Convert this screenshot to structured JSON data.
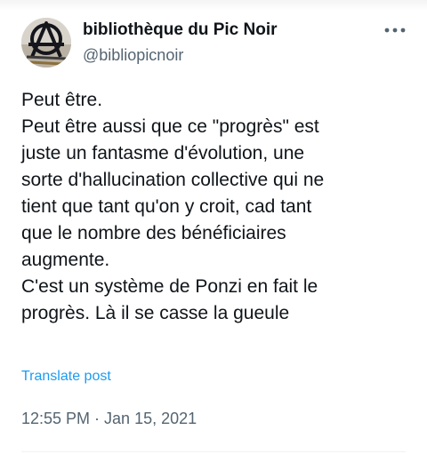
{
  "author": {
    "display_name": "bibliothèque du Pic Noir",
    "handle": "@bibliopicnoir",
    "avatar_icon": "anarchy-symbol-avatar"
  },
  "header": {
    "more_icon": "more-options-icon"
  },
  "tweet": {
    "lines": [
      "Peut être.",
      "Peut être aussi que ce \"progrès\" est",
      "juste un fantasme d'évolution, une",
      "sorte d'hallucination collective qui ne",
      "tient que tant qu'on y croit, cad tant",
      "que le nombre des bénéficiaires",
      "augmente.",
      "C'est un système de Ponzi en fait le",
      "progrès. Là il se casse la gueule"
    ],
    "translate_label": "Translate post",
    "timestamp": "12:55 PM · Jan 15, 2021"
  },
  "colors": {
    "text": "#0f1419",
    "secondary": "#536471",
    "link": "#1d9bf0"
  }
}
